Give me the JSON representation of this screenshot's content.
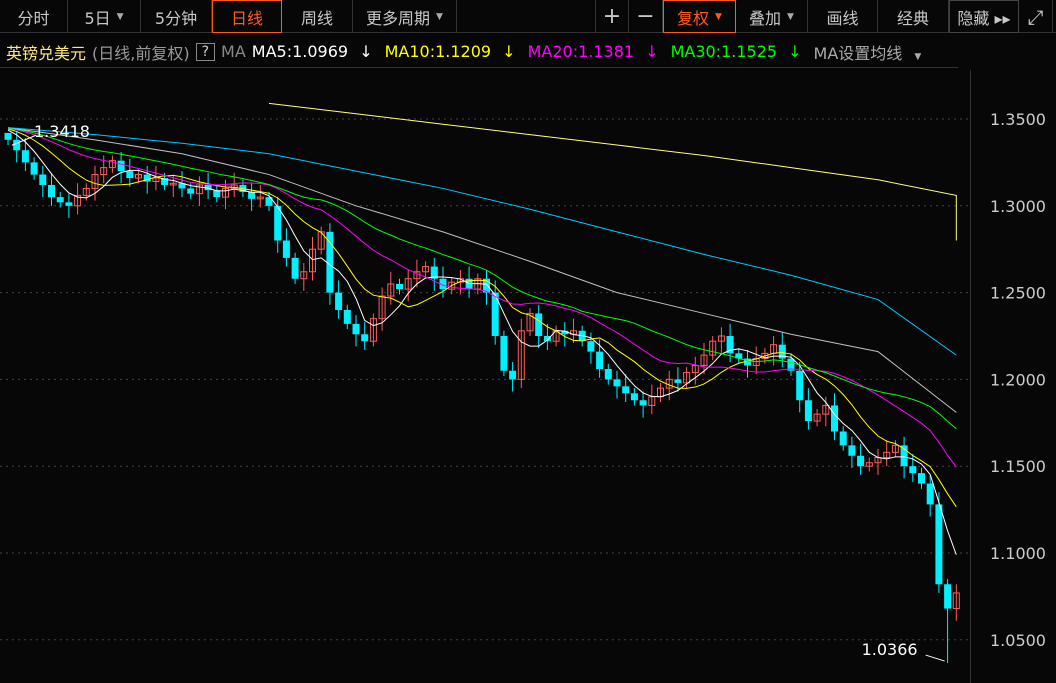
{
  "toolbar": {
    "left": [
      {
        "label": "分时"
      },
      {
        "label": "5日",
        "dropdown": true
      },
      {
        "label": "5分钟"
      },
      {
        "label": "日线",
        "active": true
      },
      {
        "label": "周线"
      },
      {
        "label": "更多周期",
        "dropdown": true
      }
    ],
    "right": [
      {
        "label": "+"
      },
      {
        "label": "−"
      },
      {
        "label": "复权",
        "dropdown": true,
        "active": true
      },
      {
        "label": "叠加",
        "dropdown": true
      },
      {
        "label": "画线"
      },
      {
        "label": "经典"
      },
      {
        "label": "隐藏 ▸▸"
      },
      {
        "label": "⤢"
      }
    ]
  },
  "legend": {
    "name": "英镑兑美元",
    "mode": "(日线,前复权)",
    "help": "?",
    "ma_label": "MA",
    "ma": [
      {
        "text": "MA5:1.0969",
        "arrow": "↓",
        "color": "#ffffff"
      },
      {
        "text": "MA10:1.1209",
        "arrow": "↓",
        "color": "#ffff00"
      },
      {
        "text": "MA20:1.1381",
        "arrow": "↓",
        "color": "#ff00ff"
      },
      {
        "text": "MA30:1.1525",
        "arrow": "↓",
        "color": "#00ff00"
      }
    ],
    "settings": "MA设置均线"
  },
  "colors": {
    "up": "#ff5c5c",
    "down": "#00f0ff",
    "ma5": "#ffffff",
    "ma10": "#ffff00",
    "ma20": "#ff00ff",
    "ma30": "#00ff00",
    "ma60": "#c0c0c0",
    "ma120": "#00c8ff",
    "ma250": "#ffff80"
  },
  "chart_data": {
    "type": "candlestick",
    "title": "英镑兑美元 (日线,前复权)",
    "ylim": [
      1.025,
      1.38
    ],
    "yticks": [
      "1.3500",
      "1.3000",
      "1.2500",
      "1.2000",
      "1.1500",
      "1.1000",
      "1.0500"
    ],
    "annotations": {
      "high": "1.3418",
      "low": "1.0366"
    },
    "open0": 1.342,
    "closes": [
      1.338,
      1.332,
      1.325,
      1.318,
      1.312,
      1.305,
      1.302,
      1.3,
      1.306,
      1.31,
      1.318,
      1.322,
      1.326,
      1.32,
      1.316,
      1.318,
      1.314,
      1.316,
      1.312,
      1.313,
      1.31,
      1.307,
      1.312,
      1.309,
      1.305,
      1.31,
      1.312,
      1.308,
      1.304,
      1.305,
      1.3,
      1.28,
      1.27,
      1.258,
      1.262,
      1.275,
      1.285,
      1.25,
      1.24,
      1.232,
      1.226,
      1.222,
      1.235,
      1.248,
      1.255,
      1.252,
      1.258,
      1.262,
      1.265,
      1.258,
      1.252,
      1.256,
      1.258,
      1.252,
      1.258,
      1.25,
      1.225,
      1.205,
      1.2,
      1.228,
      1.238,
      1.225,
      1.222,
      1.228,
      1.226,
      1.228,
      1.222,
      1.216,
      1.206,
      1.2,
      1.196,
      1.192,
      1.188,
      1.185,
      1.19,
      1.195,
      1.2,
      1.198,
      1.204,
      1.208,
      1.214,
      1.222,
      1.225,
      1.215,
      1.212,
      1.208,
      1.212,
      1.215,
      1.22,
      1.212,
      1.205,
      1.188,
      1.176,
      1.18,
      1.185,
      1.17,
      1.162,
      1.156,
      1.15,
      1.152,
      1.155,
      1.158,
      1.162,
      1.15,
      1.146,
      1.14,
      1.128,
      1.082,
      1.068,
      1.077
    ],
    "long_ma": {
      "ma60": {
        "every": 10,
        "values": [
          1.345,
          1.338,
          1.33,
          1.318,
          1.3,
          1.285,
          1.268,
          1.25,
          1.238,
          1.226,
          1.216,
          1.181
        ]
      },
      "ma120": {
        "every": 10,
        "values": [
          1.345,
          1.341,
          1.336,
          1.33,
          1.32,
          1.31,
          1.298,
          1.285,
          1.272,
          1.26,
          1.246,
          1.214
        ]
      },
      "ma250": {
        "start": 30,
        "every": 10,
        "values": [
          1.359,
          1.353,
          1.347,
          1.341,
          1.335,
          1.329,
          1.322,
          1.315,
          1.306,
          1.28
        ]
      }
    }
  }
}
